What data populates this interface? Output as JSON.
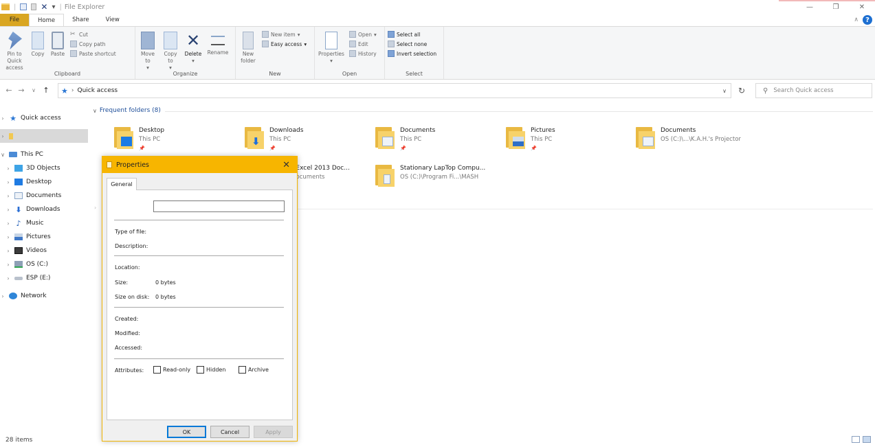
{
  "window": {
    "title": "File Explorer"
  },
  "ribbon_tabs": [
    "File",
    "Home",
    "Share",
    "View"
  ],
  "ribbon": {
    "clipboard": {
      "label": "Clipboard",
      "pin": "Pin to Quick access",
      "copy": "Copy",
      "paste": "Paste",
      "cut": "Cut",
      "copy_path": "Copy path",
      "paste_shortcut": "Paste shortcut"
    },
    "organize": {
      "label": "Organize",
      "move_to": "Move to",
      "copy_to": "Copy to",
      "delete": "Delete",
      "rename": "Rename"
    },
    "new": {
      "label": "New",
      "new_folder": "New folder",
      "new_item": "New item",
      "easy_access": "Easy access"
    },
    "open": {
      "label": "Open",
      "properties": "Properties",
      "open": "Open",
      "edit": "Edit",
      "history": "History"
    },
    "select": {
      "label": "Select",
      "select_all": "Select all",
      "select_none": "Select none",
      "invert": "Invert selection"
    }
  },
  "address": {
    "path": "Quick access",
    "search_placeholder": "Search Quick access"
  },
  "nav": {
    "quick_access": "Quick access",
    "this_pc": "This PC",
    "items": [
      "3D Objects",
      "Desktop",
      "Documents",
      "Downloads",
      "Music",
      "Pictures",
      "Videos",
      "OS (C:)",
      "ESP (E:)"
    ],
    "network": "Network"
  },
  "content": {
    "section_title": "Frequent folders (8)",
    "folders": [
      {
        "name": "Desktop",
        "location": "This PC"
      },
      {
        "name": "Downloads",
        "location": "This PC"
      },
      {
        "name": "Documents",
        "location": "This PC"
      },
      {
        "name": "Pictures",
        "location": "This PC"
      },
      {
        "name": "Documents",
        "location": "OS (C:)\\...\\K.A.H.'s Projector"
      },
      {
        "name": "t Excel 2013 Doc...",
        "location": "Documents"
      },
      {
        "name": "Stationary LapTop Compu...",
        "location": "OS (C:)\\Program Fi...\\MASH"
      }
    ]
  },
  "status": {
    "items_count": "28 items"
  },
  "dialog": {
    "title": "Properties",
    "tab": "General",
    "name_value": "",
    "labels": {
      "type": "Type of file:",
      "description": "Description:",
      "location": "Location:",
      "size": "Size:",
      "size_on_disk": "Size on disk:",
      "created": "Created:",
      "modified": "Modified:",
      "accessed": "Accessed:",
      "attributes": "Attributes:"
    },
    "values": {
      "size": "0 bytes",
      "size_on_disk": "0 bytes"
    },
    "attributes": {
      "read_only": "Read-only",
      "hidden": "Hidden",
      "archive": "Archive"
    },
    "buttons": {
      "ok": "OK",
      "cancel": "Cancel",
      "apply": "Apply"
    }
  }
}
